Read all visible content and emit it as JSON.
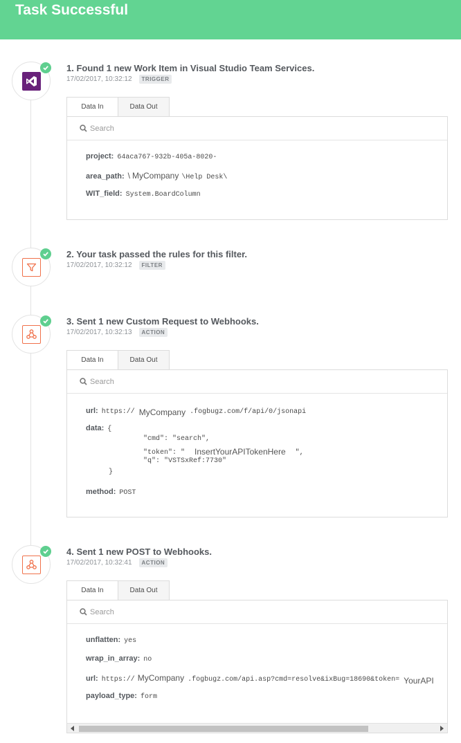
{
  "header": {
    "title": "Task Successful"
  },
  "tabs": {
    "data_in": "Data In",
    "data_out": "Data Out"
  },
  "search": {
    "placeholder": "Search"
  },
  "steps": [
    {
      "title": "1. Found 1 new Work Item in Visual Studio Team Services.",
      "timestamp": "17/02/2017, 10:32:12",
      "badge": "TRIGGER",
      "icon": "visual-studio-icon",
      "fields": [
        {
          "key": "project:",
          "value": "64aca767-932b-405a-8020-"
        },
        {
          "key": "area_path:",
          "pre": "\\",
          "redacted": "MyCompany",
          "post": "\\Help Desk\\"
        },
        {
          "key": "WIT_field:",
          "value": "System.BoardColumn"
        }
      ]
    },
    {
      "title": "2. Your task passed the rules for this filter.",
      "timestamp": "17/02/2017, 10:32:12",
      "badge": "FILTER",
      "icon": "filter-icon"
    },
    {
      "title": "3. Sent 1 new Custom Request to Webhooks.",
      "timestamp": "17/02/2017, 10:32:13",
      "badge": "ACTION",
      "icon": "webhook-icon",
      "url": {
        "key": "url:",
        "pre": "https://",
        "redacted": "MyCompany",
        "post": ".fogbugz.com/f/api/0/jsonapi"
      },
      "data_key": "data:",
      "data_lines": {
        "open": "{",
        "cmd": "\"cmd\": \"search\",",
        "token_pre": "\"token\": \"",
        "token_redacted": "InsertYourAPITokenHere",
        "token_post": "\",",
        "q": "\"q\": \"VSTSxRef:7730\"",
        "close": "}"
      },
      "method": {
        "key": "method:",
        "value": "POST"
      }
    },
    {
      "title": "4. Sent 1 new POST to Webhooks.",
      "timestamp": "17/02/2017, 10:32:41",
      "badge": "ACTION",
      "icon": "webhook-icon",
      "unflatten": {
        "key": "unflatten:",
        "value": "yes"
      },
      "wrap": {
        "key": "wrap_in_array:",
        "value": "no"
      },
      "url": {
        "key": "url:",
        "pre": "https://",
        "redacted": "MyCompany",
        "post": ".fogbugz.com/api.asp?cmd=resolve&ixBug=18690&token=",
        "redacted2": "YourAPI"
      },
      "payload": {
        "key": "payload_type:",
        "value": "form"
      }
    }
  ]
}
